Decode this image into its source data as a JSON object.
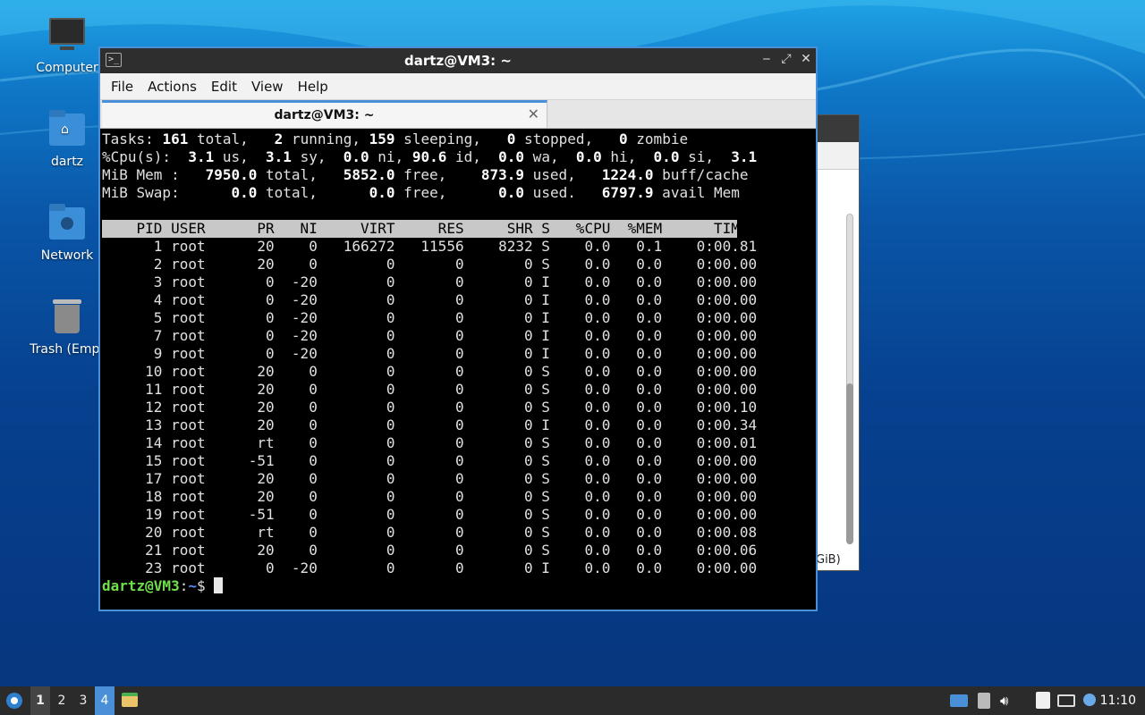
{
  "desktop": {
    "icons": [
      {
        "label": "Computer"
      },
      {
        "label": "dartz"
      },
      {
        "label": "Network"
      },
      {
        "label": "Trash (Empt"
      }
    ]
  },
  "background_window": {
    "partial_text": "GiB)"
  },
  "terminal": {
    "title": "dartz@VM3: ~",
    "menu": [
      "File",
      "Actions",
      "Edit",
      "View",
      "Help"
    ],
    "tab_label": "dartz@VM3: ~",
    "summary": {
      "tasks": {
        "total": "161",
        "running": "2",
        "sleeping": "159",
        "stopped": "0",
        "zombie": "0"
      },
      "cpu": {
        "us": "3.1",
        "sy": "3.1",
        "ni": "0.0",
        "id": "90.6",
        "wa": "0.0",
        "hi": "0.0",
        "si": "0.0",
        "st": "3.1"
      },
      "mem": {
        "total": "7950.0",
        "free": "5852.0",
        "used": "873.9",
        "buff_cache": "1224.0"
      },
      "swap": {
        "total": "0.0",
        "free": "0.0",
        "used": "0.0",
        "avail_mem": "6797.9"
      }
    },
    "columns": [
      "PID",
      "USER",
      "PR",
      "NI",
      "VIRT",
      "RES",
      "SHR",
      "S",
      "%CPU",
      "%MEM",
      "TIME+"
    ],
    "processes": [
      [
        "1",
        "root",
        "20",
        "0",
        "166272",
        "11556",
        "8232",
        "S",
        "0.0",
        "0.1",
        "0:00.81"
      ],
      [
        "2",
        "root",
        "20",
        "0",
        "0",
        "0",
        "0",
        "S",
        "0.0",
        "0.0",
        "0:00.00"
      ],
      [
        "3",
        "root",
        "0",
        "-20",
        "0",
        "0",
        "0",
        "I",
        "0.0",
        "0.0",
        "0:00.00"
      ],
      [
        "4",
        "root",
        "0",
        "-20",
        "0",
        "0",
        "0",
        "I",
        "0.0",
        "0.0",
        "0:00.00"
      ],
      [
        "5",
        "root",
        "0",
        "-20",
        "0",
        "0",
        "0",
        "I",
        "0.0",
        "0.0",
        "0:00.00"
      ],
      [
        "7",
        "root",
        "0",
        "-20",
        "0",
        "0",
        "0",
        "I",
        "0.0",
        "0.0",
        "0:00.00"
      ],
      [
        "9",
        "root",
        "0",
        "-20",
        "0",
        "0",
        "0",
        "I",
        "0.0",
        "0.0",
        "0:00.00"
      ],
      [
        "10",
        "root",
        "20",
        "0",
        "0",
        "0",
        "0",
        "S",
        "0.0",
        "0.0",
        "0:00.00"
      ],
      [
        "11",
        "root",
        "20",
        "0",
        "0",
        "0",
        "0",
        "S",
        "0.0",
        "0.0",
        "0:00.00"
      ],
      [
        "12",
        "root",
        "20",
        "0",
        "0",
        "0",
        "0",
        "S",
        "0.0",
        "0.0",
        "0:00.10"
      ],
      [
        "13",
        "root",
        "20",
        "0",
        "0",
        "0",
        "0",
        "I",
        "0.0",
        "0.0",
        "0:00.34"
      ],
      [
        "14",
        "root",
        "rt",
        "0",
        "0",
        "0",
        "0",
        "S",
        "0.0",
        "0.0",
        "0:00.01"
      ],
      [
        "15",
        "root",
        "-51",
        "0",
        "0",
        "0",
        "0",
        "S",
        "0.0",
        "0.0",
        "0:00.00"
      ],
      [
        "17",
        "root",
        "20",
        "0",
        "0",
        "0",
        "0",
        "S",
        "0.0",
        "0.0",
        "0:00.00"
      ],
      [
        "18",
        "root",
        "20",
        "0",
        "0",
        "0",
        "0",
        "S",
        "0.0",
        "0.0",
        "0:00.00"
      ],
      [
        "19",
        "root",
        "-51",
        "0",
        "0",
        "0",
        "0",
        "S",
        "0.0",
        "0.0",
        "0:00.00"
      ],
      [
        "20",
        "root",
        "rt",
        "0",
        "0",
        "0",
        "0",
        "S",
        "0.0",
        "0.0",
        "0:00.08"
      ],
      [
        "21",
        "root",
        "20",
        "0",
        "0",
        "0",
        "0",
        "S",
        "0.0",
        "0.0",
        "0:00.06"
      ],
      [
        "23",
        "root",
        "0",
        "-20",
        "0",
        "0",
        "0",
        "I",
        "0.0",
        "0.0",
        "0:00.00"
      ]
    ],
    "prompt": {
      "user_host": "dartz@VM3",
      "separator": ":",
      "path": "~",
      "symbol": "$"
    }
  },
  "taskbar": {
    "workspaces": [
      "1",
      "2",
      "3",
      "4"
    ],
    "active_workspace": "4",
    "clock": "11:10",
    "accent_color": "#4a90d9"
  }
}
